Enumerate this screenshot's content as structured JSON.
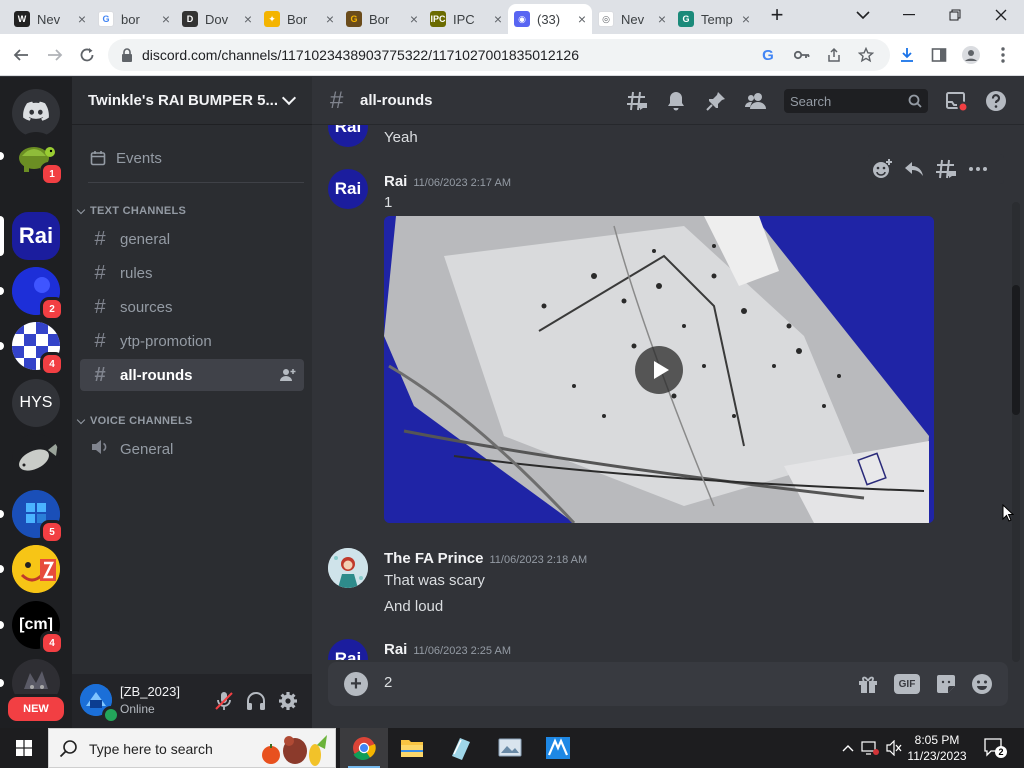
{
  "browser": {
    "tabs": [
      {
        "title": "Nev",
        "favicon": "wikipedia-favicon",
        "active": false
      },
      {
        "title": "bor",
        "favicon": "google-favicon",
        "active": false
      },
      {
        "title": "Dov",
        "favicon": "document-favicon",
        "active": false
      },
      {
        "title": "Bor",
        "favicon": "fan-favicon",
        "active": false
      },
      {
        "title": "Bor",
        "favicon": "g-favicon",
        "active": false
      },
      {
        "title": "IPC",
        "favicon": "ipc-favicon",
        "active": false
      },
      {
        "title": "(33)",
        "favicon": "discord-favicon",
        "active": true
      },
      {
        "title": "Nev",
        "favicon": "chrome-favicon",
        "active": false
      },
      {
        "title": "Temp M",
        "favicon": "temp-mail-favicon",
        "active": false
      }
    ],
    "new_tab_label": "+",
    "url": "discord.com/channels/1171023438903775322/1171027001835012126"
  },
  "server_rail": {
    "servers": [
      {
        "name": "turtle-server",
        "label": "",
        "badge": "1",
        "color": "#1e1f22"
      },
      {
        "name": "rai-server",
        "label": "Rai",
        "badge": "",
        "color": "#1b1d9e",
        "active": true
      },
      {
        "name": "blue-server",
        "label": "",
        "badge": "2",
        "color": "#1d2fd8"
      },
      {
        "name": "checkered-server",
        "label": "",
        "badge": "4",
        "color": "#3443c9"
      },
      {
        "name": "hys-server",
        "label": "HYS",
        "badge": "",
        "color": "#313338"
      },
      {
        "name": "fish-server",
        "label": "",
        "badge": "",
        "color": "#1e1f22"
      },
      {
        "name": "windows-server",
        "label": "",
        "badge": "5",
        "color": "#1a4fb8"
      },
      {
        "name": "emoji-server",
        "label": "",
        "badge": "",
        "color": "#f7c516"
      },
      {
        "name": "cm-server",
        "label": "[cm]",
        "badge": "4",
        "color": "#000000"
      },
      {
        "name": "dark-server",
        "label": "",
        "badge": "",
        "color": "#2e2e33"
      }
    ],
    "new_label": "NEW"
  },
  "sidebar": {
    "server_name": "Twinkle's RAI BUMPER 5...",
    "events_label": "Events",
    "text_category": "TEXT CHANNELS",
    "text_channels": [
      "general",
      "rules",
      "sources",
      "ytp-promotion",
      "all-rounds"
    ],
    "selected_channel": "all-rounds",
    "voice_category": "VOICE CHANNELS",
    "voice_channels": [
      "General"
    ]
  },
  "user": {
    "name": "[ZB_2023]",
    "status": "Online"
  },
  "chat": {
    "channel": "all-rounds",
    "search_placeholder": "Search",
    "messages": [
      {
        "author": "",
        "time": "",
        "avatar": "Rai",
        "lines": [
          "Yeah"
        ]
      },
      {
        "author": "Rai",
        "time": "11/06/2023 2:17 AM",
        "avatar": "Rai",
        "lines": [
          "1"
        ],
        "attachment": "video"
      },
      {
        "author": "The FA Prince",
        "time": "11/06/2023 2:18 AM",
        "avatar": "fa-prince",
        "lines": [
          "That was scary",
          "And loud"
        ]
      },
      {
        "author": "Rai",
        "time": "11/06/2023 2:25 AM",
        "avatar": "Rai",
        "lines": []
      }
    ],
    "composer_text": "2",
    "gif_label": "GIF"
  },
  "taskbar": {
    "search_placeholder": "Type here to search",
    "time": "8:05 PM",
    "date": "11/23/2023",
    "notification_count": "2"
  },
  "colors": {
    "discord_bg": "#313338",
    "sidebar_bg": "#2b2d31",
    "rail_bg": "#1e1f22",
    "rai_blue": "#1b1d9e",
    "badge_red": "#f23f43",
    "online_green": "#23a55a"
  }
}
